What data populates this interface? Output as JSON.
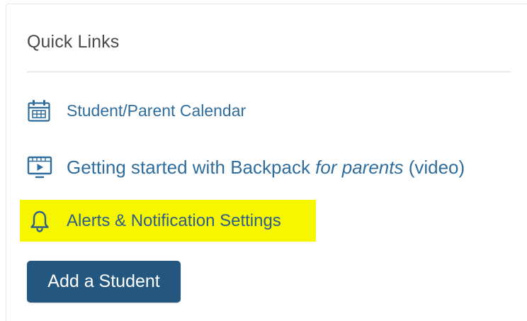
{
  "quick_links": {
    "title": "Quick Links",
    "items": [
      {
        "icon": "calendar-icon",
        "label": "Student/Parent Calendar"
      },
      {
        "icon": "video-icon",
        "label_before": "Getting started with Backpack ",
        "label_italic": "for parents",
        "label_after": " (video)"
      },
      {
        "icon": "bell-icon",
        "label": "Alerts & Notification Settings",
        "highlight_color": "#f6f600"
      }
    ],
    "add_student_label": "Add a Student"
  },
  "colors": {
    "link": "#2f6d9c",
    "button": "#24577f",
    "title": "#4a4a4a"
  }
}
